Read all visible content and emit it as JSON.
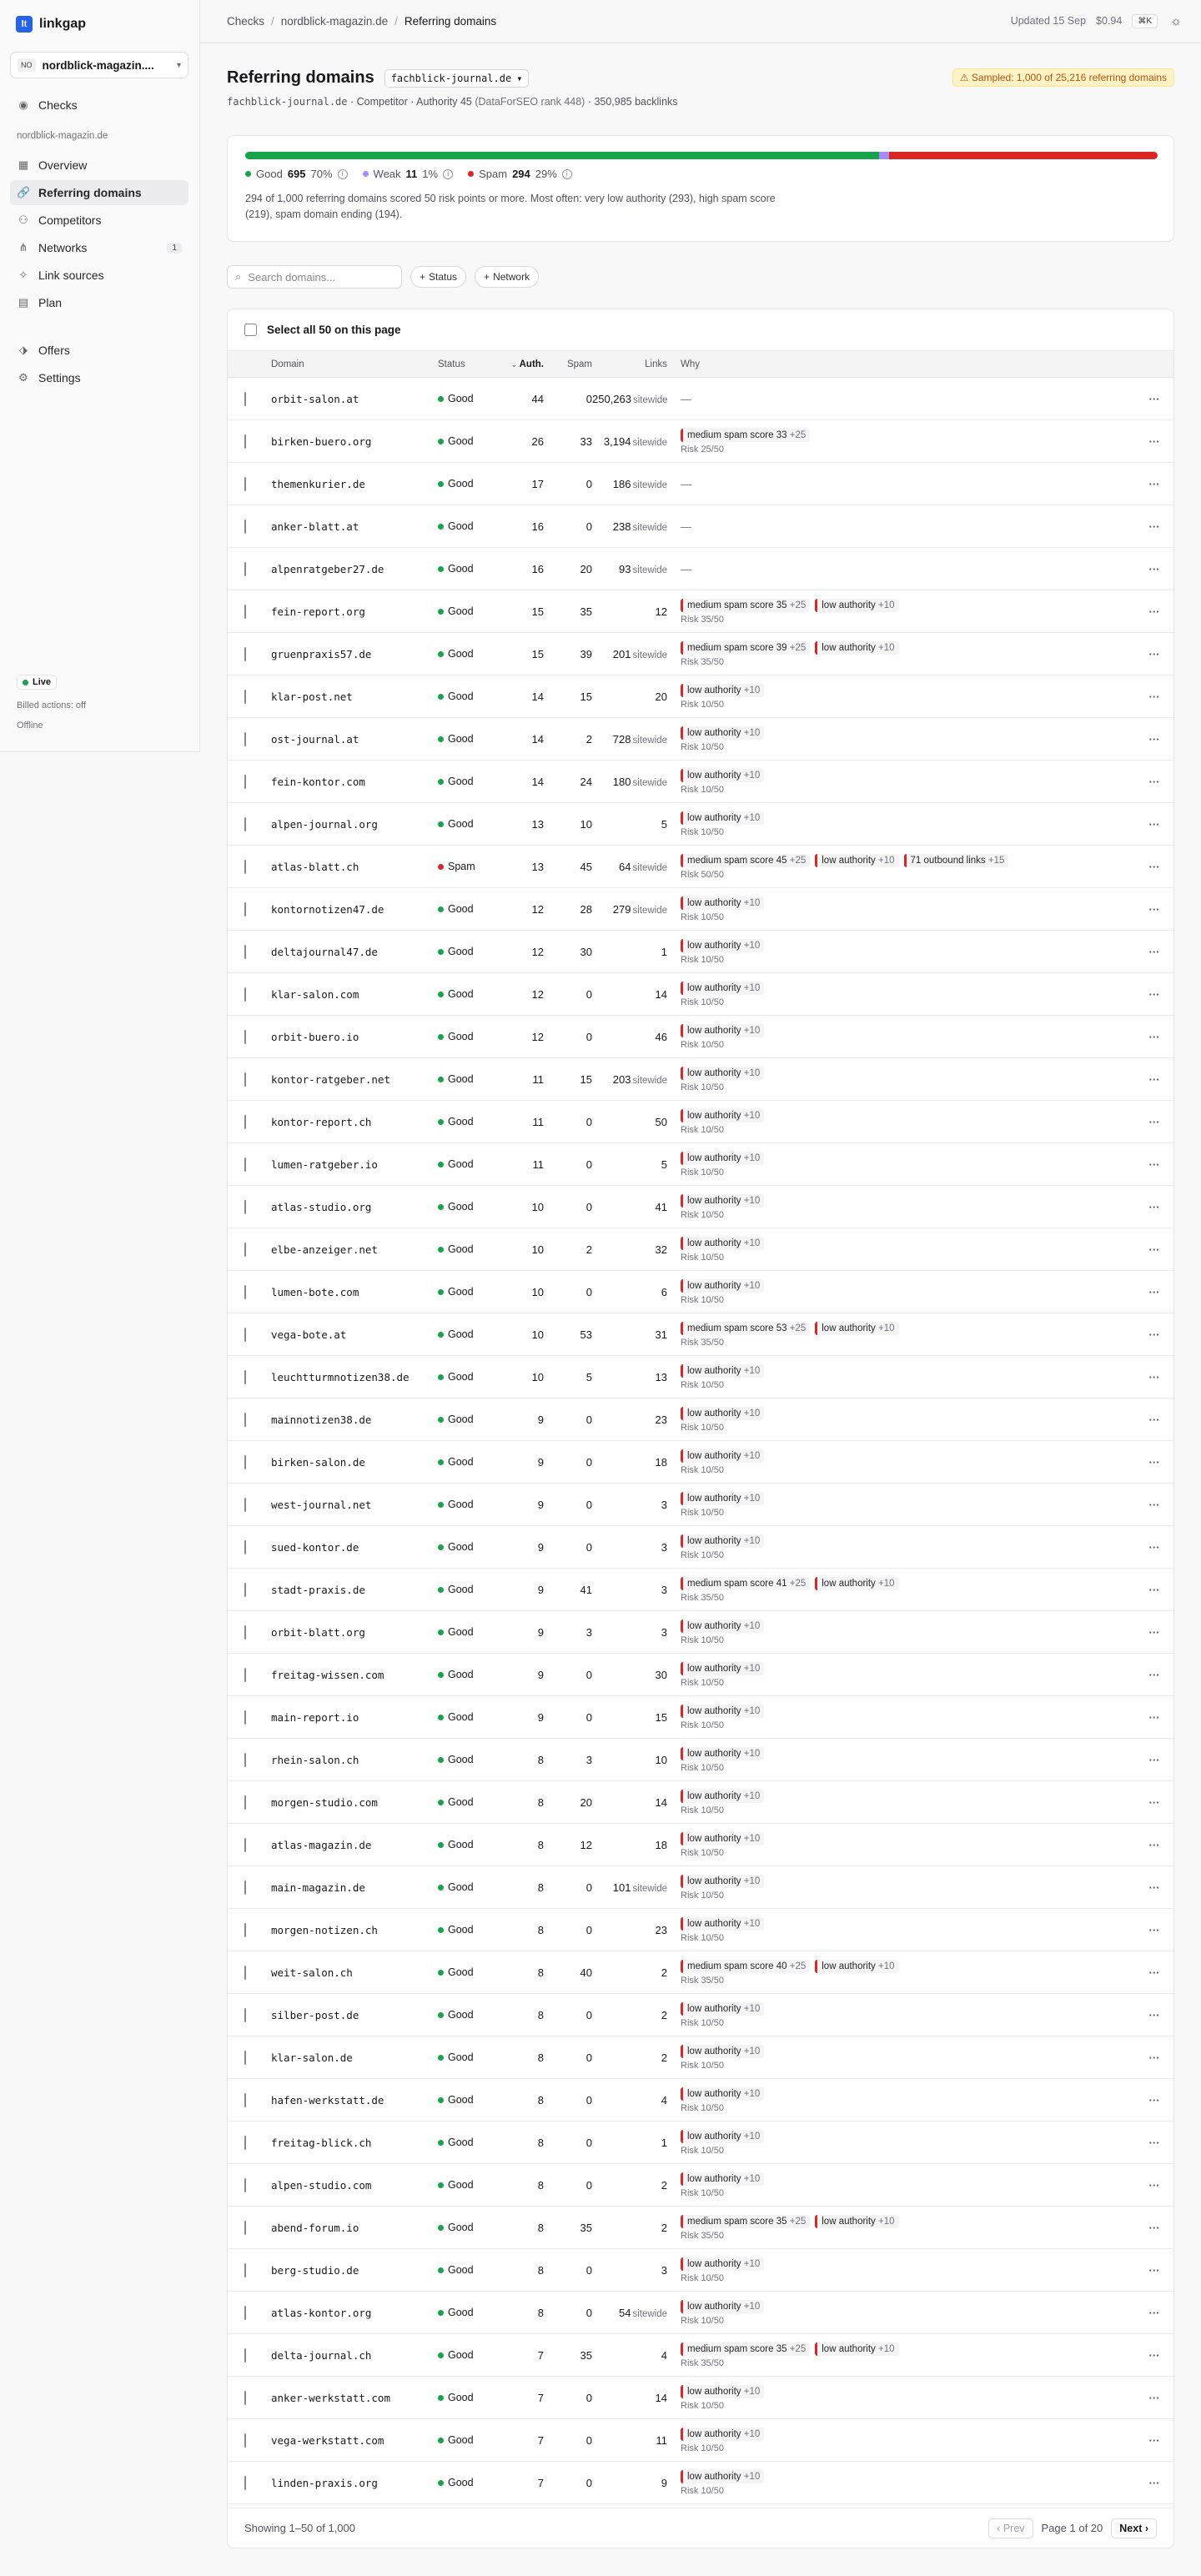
{
  "app": {
    "name": "linkgap",
    "logo_glyph": "lt"
  },
  "sidebar": {
    "project": {
      "badge": "NO",
      "name": "nordblick-magazin...."
    },
    "checks_label": "Checks",
    "section_label": "nordblick-magazin.de",
    "items": [
      {
        "label": "Overview",
        "icon": "grid-icon"
      },
      {
        "label": "Referring domains",
        "icon": "link-icon",
        "active": true
      },
      {
        "label": "Competitors",
        "icon": "users-icon"
      },
      {
        "label": "Networks",
        "icon": "network-icon",
        "count": "1"
      },
      {
        "label": "Link sources",
        "icon": "sparkle-icon"
      },
      {
        "label": "Plan",
        "icon": "calendar-icon"
      }
    ],
    "offers_label": "Offers",
    "settings_label": "Settings",
    "status": {
      "live": "Live",
      "billed": "Billed actions: off",
      "offline": "Offline"
    }
  },
  "topbar": {
    "breadcrumb": [
      "Checks",
      "nordblick-magazin.de",
      "Referring domains"
    ],
    "updated": "Updated 15 Sep",
    "cost": "$0.94",
    "shortcut": "⌘K"
  },
  "header": {
    "title": "Referring domains",
    "selector": "fachblick-journal.de",
    "sampled": "Sampled: 1,000 of 25,216 referring domains",
    "sub_domain": "fachblick-journal.de",
    "sub_rest": " · Competitor · Authority 45 ",
    "sub_rank": "(DataForSEO rank 448)",
    "sub_backlinks": " · 350,985 backlinks"
  },
  "summary": {
    "good": {
      "label": "Good",
      "count": "695",
      "pct": "70%",
      "fraction": 0.695,
      "color": "#16a34a"
    },
    "weak": {
      "label": "Weak",
      "count": "11",
      "pct": "1%",
      "fraction": 0.011,
      "color": "#a78bfa"
    },
    "spam": {
      "label": "Spam",
      "count": "294",
      "pct": "29%",
      "fraction": 0.294,
      "color": "#dc2626"
    },
    "text": "294 of 1,000 referring domains scored 50 risk points or more. Most often: very low authority (293), high spam score (219), spam domain ending (194)."
  },
  "filters": {
    "search_placeholder": "Search domains...",
    "status": "Status",
    "network": "Network"
  },
  "table": {
    "select_all": "Select all 50 on this page",
    "columns": {
      "domain": "Domain",
      "status": "Status",
      "auth": "Auth.",
      "spam": "Spam",
      "links": "Links",
      "why": "Why"
    },
    "sitewide_label": "sitewide",
    "rows": [
      {
        "domain": "orbit-salon.at",
        "status": "Good",
        "auth": "44",
        "spam": "0",
        "links": "250,263",
        "sitewide": true,
        "why": [],
        "risk": ""
      },
      {
        "domain": "birken-buero.org",
        "status": "Good",
        "auth": "26",
        "spam": "33",
        "links": "3,194",
        "sitewide": true,
        "why": [
          [
            "medium spam score 33",
            "+25"
          ]
        ],
        "risk": "Risk 25/50"
      },
      {
        "domain": "themenkurier.de",
        "status": "Good",
        "auth": "17",
        "spam": "0",
        "links": "186",
        "sitewide": true,
        "why": [],
        "risk": ""
      },
      {
        "domain": "anker-blatt.at",
        "status": "Good",
        "auth": "16",
        "spam": "0",
        "links": "238",
        "sitewide": true,
        "why": [],
        "risk": ""
      },
      {
        "domain": "alpenratgeber27.de",
        "status": "Good",
        "auth": "16",
        "spam": "20",
        "links": "93",
        "sitewide": true,
        "why": [],
        "risk": ""
      },
      {
        "domain": "fein-report.org",
        "status": "Good",
        "auth": "15",
        "spam": "35",
        "links": "12",
        "sitewide": false,
        "why": [
          [
            "medium spam score 35",
            "+25"
          ],
          [
            "low authority",
            "+10"
          ]
        ],
        "risk": "Risk 35/50"
      },
      {
        "domain": "gruenpraxis57.de",
        "status": "Good",
        "auth": "15",
        "spam": "39",
        "links": "201",
        "sitewide": true,
        "why": [
          [
            "medium spam score 39",
            "+25"
          ],
          [
            "low authority",
            "+10"
          ]
        ],
        "risk": "Risk 35/50"
      },
      {
        "domain": "klar-post.net",
        "status": "Good",
        "auth": "14",
        "spam": "15",
        "links": "20",
        "sitewide": false,
        "why": [
          [
            "low authority",
            "+10"
          ]
        ],
        "risk": "Risk 10/50"
      },
      {
        "domain": "ost-journal.at",
        "status": "Good",
        "auth": "14",
        "spam": "2",
        "links": "728",
        "sitewide": true,
        "why": [
          [
            "low authority",
            "+10"
          ]
        ],
        "risk": "Risk 10/50"
      },
      {
        "domain": "fein-kontor.com",
        "status": "Good",
        "auth": "14",
        "spam": "24",
        "links": "180",
        "sitewide": true,
        "why": [
          [
            "low authority",
            "+10"
          ]
        ],
        "risk": "Risk 10/50"
      },
      {
        "domain": "alpen-journal.org",
        "status": "Good",
        "auth": "13",
        "spam": "10",
        "links": "5",
        "sitewide": false,
        "why": [
          [
            "low authority",
            "+10"
          ]
        ],
        "risk": "Risk 10/50"
      },
      {
        "domain": "atlas-blatt.ch",
        "status": "Spam",
        "auth": "13",
        "spam": "45",
        "links": "64",
        "sitewide": true,
        "why": [
          [
            "medium spam score 45",
            "+25"
          ],
          [
            "low authority",
            "+10"
          ],
          [
            "71 outbound links",
            "+15"
          ]
        ],
        "risk": "Risk 50/50"
      },
      {
        "domain": "kontornotizen47.de",
        "status": "Good",
        "auth": "12",
        "spam": "28",
        "links": "279",
        "sitewide": true,
        "why": [
          [
            "low authority",
            "+10"
          ]
        ],
        "risk": "Risk 10/50"
      },
      {
        "domain": "deltajournal47.de",
        "status": "Good",
        "auth": "12",
        "spam": "30",
        "links": "1",
        "sitewide": false,
        "why": [
          [
            "low authority",
            "+10"
          ]
        ],
        "risk": "Risk 10/50"
      },
      {
        "domain": "klar-salon.com",
        "status": "Good",
        "auth": "12",
        "spam": "0",
        "links": "14",
        "sitewide": false,
        "why": [
          [
            "low authority",
            "+10"
          ]
        ],
        "risk": "Risk 10/50"
      },
      {
        "domain": "orbit-buero.io",
        "status": "Good",
        "auth": "12",
        "spam": "0",
        "links": "46",
        "sitewide": false,
        "why": [
          [
            "low authority",
            "+10"
          ]
        ],
        "risk": "Risk 10/50"
      },
      {
        "domain": "kontor-ratgeber.net",
        "status": "Good",
        "auth": "11",
        "spam": "15",
        "links": "203",
        "sitewide": true,
        "why": [
          [
            "low authority",
            "+10"
          ]
        ],
        "risk": "Risk 10/50"
      },
      {
        "domain": "kontor-report.ch",
        "status": "Good",
        "auth": "11",
        "spam": "0",
        "links": "50",
        "sitewide": false,
        "why": [
          [
            "low authority",
            "+10"
          ]
        ],
        "risk": "Risk 10/50"
      },
      {
        "domain": "lumen-ratgeber.io",
        "status": "Good",
        "auth": "11",
        "spam": "0",
        "links": "5",
        "sitewide": false,
        "why": [
          [
            "low authority",
            "+10"
          ]
        ],
        "risk": "Risk 10/50"
      },
      {
        "domain": "atlas-studio.org",
        "status": "Good",
        "auth": "10",
        "spam": "0",
        "links": "41",
        "sitewide": false,
        "why": [
          [
            "low authority",
            "+10"
          ]
        ],
        "risk": "Risk 10/50"
      },
      {
        "domain": "elbe-anzeiger.net",
        "status": "Good",
        "auth": "10",
        "spam": "2",
        "links": "32",
        "sitewide": false,
        "why": [
          [
            "low authority",
            "+10"
          ]
        ],
        "risk": "Risk 10/50"
      },
      {
        "domain": "lumen-bote.com",
        "status": "Good",
        "auth": "10",
        "spam": "0",
        "links": "6",
        "sitewide": false,
        "why": [
          [
            "low authority",
            "+10"
          ]
        ],
        "risk": "Risk 10/50"
      },
      {
        "domain": "vega-bote.at",
        "status": "Good",
        "auth": "10",
        "spam": "53",
        "links": "31",
        "sitewide": false,
        "why": [
          [
            "medium spam score 53",
            "+25"
          ],
          [
            "low authority",
            "+10"
          ]
        ],
        "risk": "Risk 35/50"
      },
      {
        "domain": "leuchtturmnotizen38.de",
        "status": "Good",
        "auth": "10",
        "spam": "5",
        "links": "13",
        "sitewide": false,
        "why": [
          [
            "low authority",
            "+10"
          ]
        ],
        "risk": "Risk 10/50"
      },
      {
        "domain": "mainnotizen38.de",
        "status": "Good",
        "auth": "9",
        "spam": "0",
        "links": "23",
        "sitewide": false,
        "why": [
          [
            "low authority",
            "+10"
          ]
        ],
        "risk": "Risk 10/50"
      },
      {
        "domain": "birken-salon.de",
        "status": "Good",
        "auth": "9",
        "spam": "0",
        "links": "18",
        "sitewide": false,
        "why": [
          [
            "low authority",
            "+10"
          ]
        ],
        "risk": "Risk 10/50"
      },
      {
        "domain": "west-journal.net",
        "status": "Good",
        "auth": "9",
        "spam": "0",
        "links": "3",
        "sitewide": false,
        "why": [
          [
            "low authority",
            "+10"
          ]
        ],
        "risk": "Risk 10/50"
      },
      {
        "domain": "sued-kontor.de",
        "status": "Good",
        "auth": "9",
        "spam": "0",
        "links": "3",
        "sitewide": false,
        "why": [
          [
            "low authority",
            "+10"
          ]
        ],
        "risk": "Risk 10/50"
      },
      {
        "domain": "stadt-praxis.de",
        "status": "Good",
        "auth": "9",
        "spam": "41",
        "links": "3",
        "sitewide": false,
        "why": [
          [
            "medium spam score 41",
            "+25"
          ],
          [
            "low authority",
            "+10"
          ]
        ],
        "risk": "Risk 35/50"
      },
      {
        "domain": "orbit-blatt.org",
        "status": "Good",
        "auth": "9",
        "spam": "3",
        "links": "3",
        "sitewide": false,
        "why": [
          [
            "low authority",
            "+10"
          ]
        ],
        "risk": "Risk 10/50"
      },
      {
        "domain": "freitag-wissen.com",
        "status": "Good",
        "auth": "9",
        "spam": "0",
        "links": "30",
        "sitewide": false,
        "why": [
          [
            "low authority",
            "+10"
          ]
        ],
        "risk": "Risk 10/50"
      },
      {
        "domain": "main-report.io",
        "status": "Good",
        "auth": "9",
        "spam": "0",
        "links": "15",
        "sitewide": false,
        "why": [
          [
            "low authority",
            "+10"
          ]
        ],
        "risk": "Risk 10/50"
      },
      {
        "domain": "rhein-salon.ch",
        "status": "Good",
        "auth": "8",
        "spam": "3",
        "links": "10",
        "sitewide": false,
        "why": [
          [
            "low authority",
            "+10"
          ]
        ],
        "risk": "Risk 10/50"
      },
      {
        "domain": "morgen-studio.com",
        "status": "Good",
        "auth": "8",
        "spam": "20",
        "links": "14",
        "sitewide": false,
        "why": [
          [
            "low authority",
            "+10"
          ]
        ],
        "risk": "Risk 10/50"
      },
      {
        "domain": "atlas-magazin.de",
        "status": "Good",
        "auth": "8",
        "spam": "12",
        "links": "18",
        "sitewide": false,
        "why": [
          [
            "low authority",
            "+10"
          ]
        ],
        "risk": "Risk 10/50"
      },
      {
        "domain": "main-magazin.de",
        "status": "Good",
        "auth": "8",
        "spam": "0",
        "links": "101",
        "sitewide": true,
        "why": [
          [
            "low authority",
            "+10"
          ]
        ],
        "risk": "Risk 10/50"
      },
      {
        "domain": "morgen-notizen.ch",
        "status": "Good",
        "auth": "8",
        "spam": "0",
        "links": "23",
        "sitewide": false,
        "why": [
          [
            "low authority",
            "+10"
          ]
        ],
        "risk": "Risk 10/50"
      },
      {
        "domain": "weit-salon.ch",
        "status": "Good",
        "auth": "8",
        "spam": "40",
        "links": "2",
        "sitewide": false,
        "why": [
          [
            "medium spam score 40",
            "+25"
          ],
          [
            "low authority",
            "+10"
          ]
        ],
        "risk": "Risk 35/50"
      },
      {
        "domain": "silber-post.de",
        "status": "Good",
        "auth": "8",
        "spam": "0",
        "links": "2",
        "sitewide": false,
        "why": [
          [
            "low authority",
            "+10"
          ]
        ],
        "risk": "Risk 10/50"
      },
      {
        "domain": "klar-salon.de",
        "status": "Good",
        "auth": "8",
        "spam": "0",
        "links": "2",
        "sitewide": false,
        "why": [
          [
            "low authority",
            "+10"
          ]
        ],
        "risk": "Risk 10/50"
      },
      {
        "domain": "hafen-werkstatt.de",
        "status": "Good",
        "auth": "8",
        "spam": "0",
        "links": "4",
        "sitewide": false,
        "why": [
          [
            "low authority",
            "+10"
          ]
        ],
        "risk": "Risk 10/50"
      },
      {
        "domain": "freitag-blick.ch",
        "status": "Good",
        "auth": "8",
        "spam": "0",
        "links": "1",
        "sitewide": false,
        "why": [
          [
            "low authority",
            "+10"
          ]
        ],
        "risk": "Risk 10/50"
      },
      {
        "domain": "alpen-studio.com",
        "status": "Good",
        "auth": "8",
        "spam": "0",
        "links": "2",
        "sitewide": false,
        "why": [
          [
            "low authority",
            "+10"
          ]
        ],
        "risk": "Risk 10/50"
      },
      {
        "domain": "abend-forum.io",
        "status": "Good",
        "auth": "8",
        "spam": "35",
        "links": "2",
        "sitewide": false,
        "why": [
          [
            "medium spam score 35",
            "+25"
          ],
          [
            "low authority",
            "+10"
          ]
        ],
        "risk": "Risk 35/50"
      },
      {
        "domain": "berg-studio.de",
        "status": "Good",
        "auth": "8",
        "spam": "0",
        "links": "3",
        "sitewide": false,
        "why": [
          [
            "low authority",
            "+10"
          ]
        ],
        "risk": "Risk 10/50"
      },
      {
        "domain": "atlas-kontor.org",
        "status": "Good",
        "auth": "8",
        "spam": "0",
        "links": "54",
        "sitewide": true,
        "why": [
          [
            "low authority",
            "+10"
          ]
        ],
        "risk": "Risk 10/50"
      },
      {
        "domain": "delta-journal.ch",
        "status": "Good",
        "auth": "7",
        "spam": "35",
        "links": "4",
        "sitewide": false,
        "why": [
          [
            "medium spam score 35",
            "+25"
          ],
          [
            "low authority",
            "+10"
          ]
        ],
        "risk": "Risk 35/50"
      },
      {
        "domain": "anker-werkstatt.com",
        "status": "Good",
        "auth": "7",
        "spam": "0",
        "links": "14",
        "sitewide": false,
        "why": [
          [
            "low authority",
            "+10"
          ]
        ],
        "risk": "Risk 10/50"
      },
      {
        "domain": "vega-werkstatt.com",
        "status": "Good",
        "auth": "7",
        "spam": "0",
        "links": "11",
        "sitewide": false,
        "why": [
          [
            "low authority",
            "+10"
          ]
        ],
        "risk": "Risk 10/50"
      },
      {
        "domain": "linden-praxis.org",
        "status": "Good",
        "auth": "7",
        "spam": "0",
        "links": "9",
        "sitewide": false,
        "why": [
          [
            "low authority",
            "+10"
          ]
        ],
        "risk": "Risk 10/50"
      }
    ]
  },
  "pager": {
    "showing": "Showing 1–50 of 1,000",
    "prev": "Prev",
    "page": "Page 1 of 20",
    "next": "Next"
  }
}
